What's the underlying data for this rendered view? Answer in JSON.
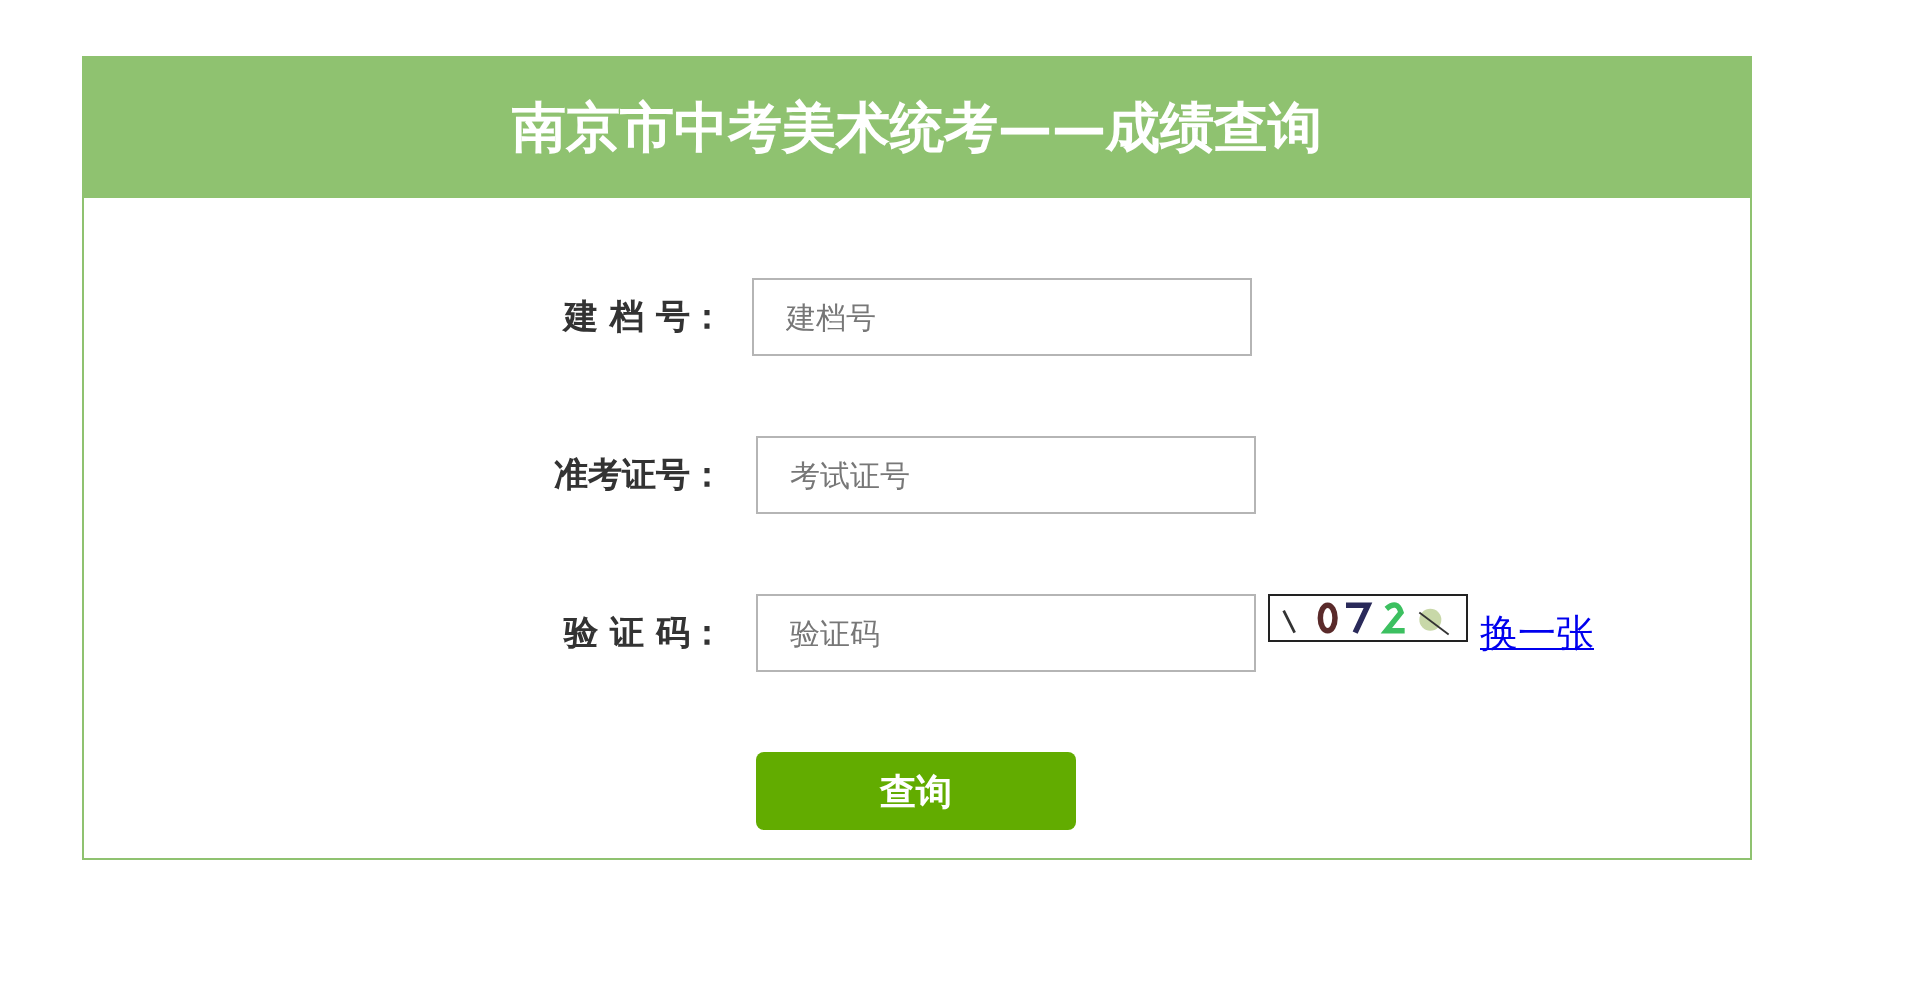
{
  "header": {
    "title": "南京市中考美术统考——成绩查询"
  },
  "fields": [
    {
      "kind": "text",
      "label": "建 档 号：",
      "placeholder": "建档号"
    },
    {
      "kind": "text",
      "label": "准考证号：",
      "placeholder": "考试证号"
    },
    {
      "kind": "captcha",
      "label": "验 证 码：",
      "placeholder": "验证码",
      "refresh_link": "换一张"
    }
  ],
  "submit_button": "查询"
}
